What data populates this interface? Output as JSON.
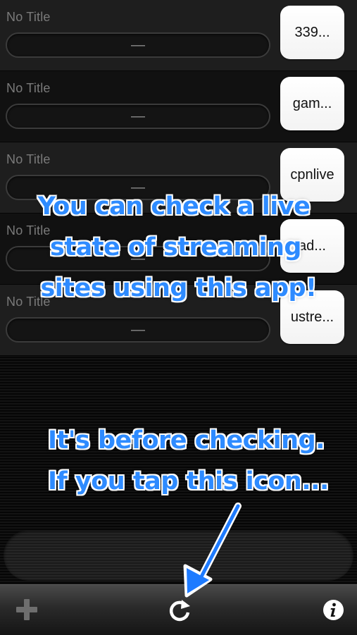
{
  "rows": [
    {
      "title": "No Title",
      "status": "—",
      "site": "339..."
    },
    {
      "title": "No Title",
      "status": "—",
      "site": "gam..."
    },
    {
      "title": "No Title",
      "status": "—",
      "site": "cpnlive"
    },
    {
      "title": "No Title",
      "status": "—",
      "site": "ad..."
    },
    {
      "title": "No Title",
      "status": "—",
      "site": "ustre..."
    }
  ],
  "annotations": {
    "main": [
      "You can check a live",
      "state of streaming",
      "sites using this app!"
    ],
    "sub": [
      "It's before checking.",
      "If you tap this icon..."
    ]
  },
  "toolbar": {
    "add_icon": "plus-icon",
    "refresh_icon": "refresh-icon",
    "info_icon": "info-icon"
  },
  "colors": {
    "annotation_text": "#2e8bff",
    "annotation_outline": "#ffffff",
    "arrow": "#1e7bff"
  }
}
